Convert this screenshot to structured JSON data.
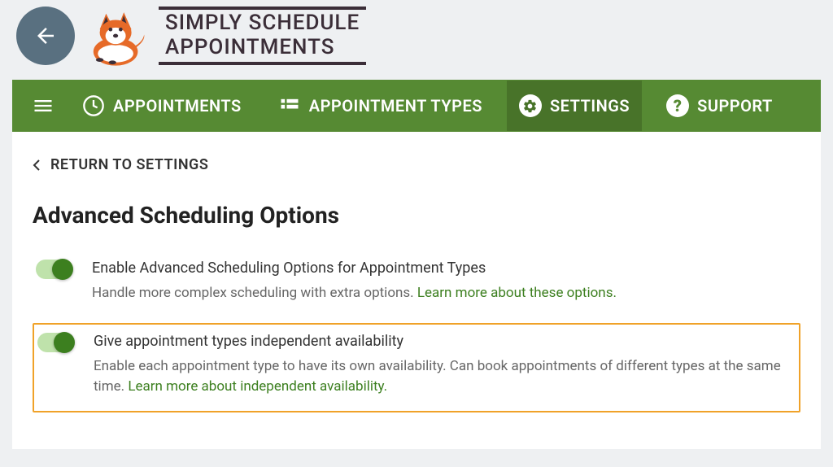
{
  "logo": {
    "line1": "SIMPLY SCHEDULE",
    "line2": "APPOINTMENTS"
  },
  "nav": {
    "items": [
      {
        "id": "appointments",
        "label": "APPOINTMENTS",
        "active": false
      },
      {
        "id": "appointment-types",
        "label": "APPOINTMENT TYPES",
        "active": false
      },
      {
        "id": "settings",
        "label": "SETTINGS",
        "active": true
      },
      {
        "id": "support",
        "label": "SUPPORT",
        "active": false
      }
    ]
  },
  "breadcrumb": {
    "text": "RETURN TO SETTINGS"
  },
  "page": {
    "title": "Advanced Scheduling Options"
  },
  "options": [
    {
      "id": "enable-advanced",
      "title": "Enable Advanced Scheduling Options for Appointment Types",
      "description": "Handle more complex scheduling with extra options. ",
      "link": "Learn more about these options.",
      "enabled": true,
      "highlighted": false
    },
    {
      "id": "independent-availability",
      "title": "Give appointment types independent availability",
      "description": "Enable each appointment type to have its own availability. Can book appointments of different types at the same time. ",
      "link": "Learn more about independent availability.",
      "enabled": true,
      "highlighted": true
    }
  ]
}
